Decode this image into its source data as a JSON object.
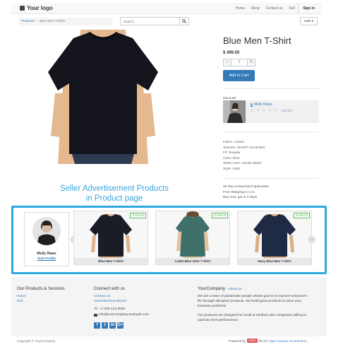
{
  "navbar": {
    "logo": "Your logo",
    "menu": [
      "Home",
      "Shop",
      "Contact us",
      "Sell"
    ],
    "signin": "Sign in"
  },
  "breadcrumb": {
    "parent": "Products",
    "current": "Blue Men T-Shirt"
  },
  "search": {
    "placeholder": "Search..."
  },
  "currency": "USD ▾",
  "product": {
    "title": "Blue Men T-Shirt",
    "price": "$ 499.00",
    "quantity": "1",
    "add_to_cart": "Add to Cart",
    "attributes": [
      "Fabric: Cotton",
      "Sleeves: SHORT SLEEVES",
      "Fit: Regular",
      "Color: Blue",
      "Wash Care: Gentle Wash",
      "Style: Solid"
    ],
    "policies": [
      "30-day money-back guarantee",
      "Free Shipping in U.S.",
      "Buy now, get in 2 days"
    ]
  },
  "seller": {
    "sold_by_label": "SOLD BY",
    "name": "Molly Raws",
    "rating_text": "( 0 / 5 )",
    "rating": 0,
    "visit_profile": "Visit Profile"
  },
  "annotation": {
    "line1": "Seller Advertisement Products",
    "line2": "in Product page"
  },
  "carousel": {
    "prev": "‹",
    "next": "›",
    "products": [
      {
        "name": "Blue Men T-Shirt",
        "price": "$ 499.00",
        "shirt_color": "#1a1c26"
      },
      {
        "name": "Cadet Blue Girls T-Shirt",
        "price": "$ 409.00",
        "shirt_color": "#3f7069"
      },
      {
        "name": "Navy Blue Men T-Shirt",
        "price": "$ 509.00",
        "shirt_color": "#1f2a44"
      }
    ]
  },
  "footer": {
    "col1": {
      "title": "Our Products & Services",
      "links": [
        "Home",
        "Sell"
      ]
    },
    "col2": {
      "title": "Connect with us",
      "links": [
        "Contact us",
        "Advertisement Blocks"
      ],
      "phone": "+1 555 123 8069",
      "email": "info@yourcompany.example.com",
      "social": [
        "f",
        "t",
        "in",
        "G+"
      ]
    },
    "col3": {
      "title": "YourCompany",
      "about_link": "- About us",
      "para1_line1": "We are a team of passionate people whose goal is to improve everyone's",
      "para1_line2": "life through disruptive products. We build great products to solve your",
      "para1_line3": "business problems.",
      "para2_line1": "Our products are designed for small to medium size companies willing to",
      "para2_line2": "optimize their performance."
    }
  },
  "bottom": {
    "copyright": "Copyright © YourCompany",
    "powered_by": "Powered by",
    "odoo": "Odoo",
    "the_1": "the #1",
    "open_source": "Open Source eCommerce."
  },
  "colors": {
    "accent": "#337ab7",
    "annotation": "#3aa6dd",
    "highlight_border": "#2ea8e0",
    "price_badge": "#5cb85c"
  }
}
